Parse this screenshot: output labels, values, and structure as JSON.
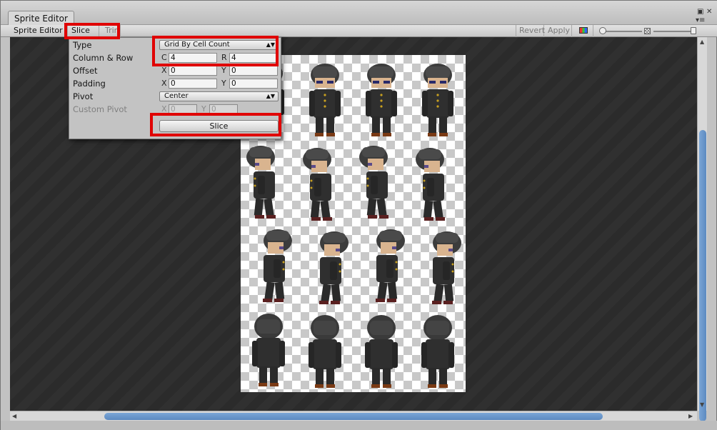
{
  "window": {
    "tab_title": "Sprite Editor"
  },
  "toolbar": {
    "mode_label": "Sprite Editor",
    "slice_label": "Slice",
    "slice_arrows": "⇕",
    "trim_label": "Trim",
    "revert_label": "Revert",
    "apply_label": "Apply"
  },
  "slice_popup": {
    "type_label": "Type",
    "type_value": "Grid By Cell Count",
    "column_row_label": "Column & Row",
    "c_axis": "C",
    "c_value": "4",
    "r_axis": "R",
    "r_value": "4",
    "offset_label": "Offset",
    "offset_x_axis": "X",
    "offset_x": "0",
    "offset_y_axis": "Y",
    "offset_y": "0",
    "padding_label": "Padding",
    "padding_x_axis": "X",
    "padding_x": "0",
    "padding_y_axis": "Y",
    "padding_y": "0",
    "pivot_label": "Pivot",
    "pivot_value": "Center",
    "custom_pivot_label": "Custom Pivot",
    "custom_x_axis": "X",
    "custom_x": "0",
    "custom_y_axis": "Y",
    "custom_y": "0",
    "slice_button": "Slice"
  },
  "sprite_sheet": {
    "rows": 4,
    "columns": 4
  },
  "colors": {
    "highlight": "#e00000",
    "scroll_thumb": "#6b96cb"
  }
}
